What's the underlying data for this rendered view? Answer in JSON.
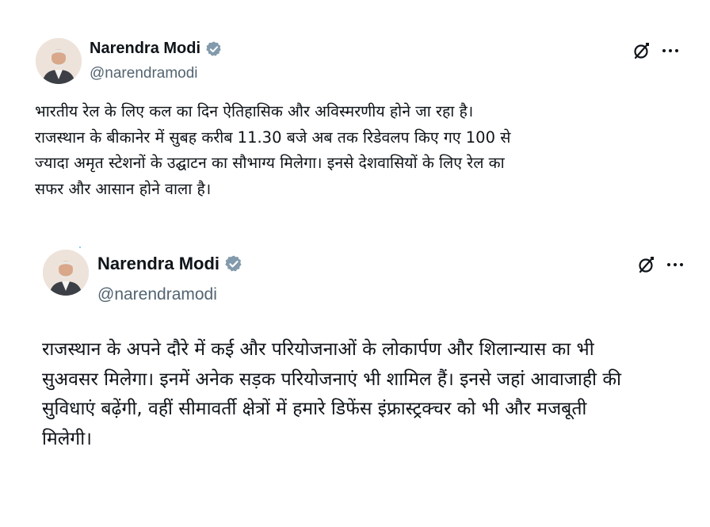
{
  "tweets": [
    {
      "author": {
        "name": "Narendra Modi",
        "handle": "@narendramodi",
        "verified": true,
        "verified_color": "#829aab"
      },
      "actions": {
        "grok_icon": "grok-icon",
        "more_icon": "more-icon"
      },
      "text": "भारतीय रेल के लिए कल का दिन ऐतिहासिक और अविस्मरणीय होने जा रहा है।\nराजस्थान के बीकानेर में सुबह करीब 11.30 बजे अब तक रिडेवलप किए गए 100 से\nज्यादा अमृत स्टेशनों के उद्घाटन का सौभाग्य मिलेगा। इनसे देशवासियों के लिए रेल का\nसफर और आसान होने वाला है।"
    },
    {
      "author": {
        "name": "Narendra Modi",
        "handle": "@narendramodi",
        "verified": true,
        "verified_color": "#829aab"
      },
      "actions": {
        "grok_icon": "grok-icon",
        "more_icon": "more-icon"
      },
      "text": "राजस्थान के अपने दौरे में कई और परियोजनाओं के लोकार्पण और शिलान्यास का भी\nसुअवसर मिलेगा। इनमें अनेक सड़क परियोजनाएं भी शामिल हैं। इनसे जहां आवाजाही की\nसुविधाएं बढ़ेंगी, वहीं सीमावर्ती क्षेत्रों में हमारे डिफेंस इंफ्रास्ट्रक्चर को भी और मजबूती\nमिलेगी।"
    }
  ]
}
